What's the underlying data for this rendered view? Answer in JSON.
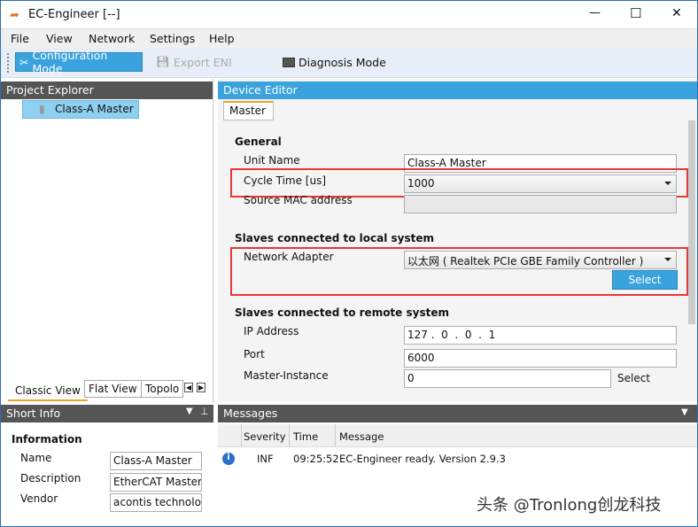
{
  "window": {
    "title": "EC-Engineer [--]",
    "minimize": "—",
    "maximize": "☐",
    "close": "✕"
  },
  "menu": [
    "File",
    "View",
    "Network",
    "Settings",
    "Help"
  ],
  "toolbar": {
    "config_mode": "Configuration Mode",
    "export_eni": "Export ENI",
    "diagnosis_mode": "Diagnosis Mode"
  },
  "project_explorer": {
    "title": "Project Explorer",
    "tree_item": "Class-A Master",
    "tabs": [
      "Classic View",
      "Flat View",
      "Topolo"
    ]
  },
  "device_editor": {
    "title": "Device Editor",
    "tab": "Master",
    "general": {
      "heading": "General",
      "unit_name_label": "Unit Name",
      "unit_name": "Class-A Master",
      "cycle_time_label": "Cycle Time [us]",
      "cycle_time": "1000",
      "mac_label": "Source MAC address",
      "mac": ""
    },
    "local": {
      "heading": "Slaves connected to local system",
      "adapter_label": "Network Adapter",
      "adapter": "以太网 ( Realtek PCIe GBE Family Controller )",
      "select": "Select"
    },
    "remote": {
      "heading": "Slaves connected to remote system",
      "ip_label": "IP Address",
      "ip": "127 .  0  .  0  .  1",
      "port_label": "Port",
      "port": "6000",
      "instance_label": "Master-Instance",
      "instance": "0",
      "select": "Select"
    }
  },
  "short_info": {
    "title": "Short Info",
    "heading": "Information",
    "name_label": "Name",
    "name": "Class-A Master",
    "desc_label": "Description",
    "desc": "EtherCAT Master",
    "vendor_label": "Vendor",
    "vendor": "acontis technologies"
  },
  "messages": {
    "title": "Messages",
    "columns": [
      "Severity",
      "Time",
      "Message"
    ],
    "rows": [
      {
        "severity": "INF",
        "time": "09:25:52",
        "message": "EC-Engineer ready. Version 2.9.3"
      }
    ]
  },
  "watermark": "头条 @Tronlong创龙科技",
  "colors": {
    "accent": "#3aa3de",
    "dark_header": "#555555",
    "highlight": "#e53935"
  }
}
